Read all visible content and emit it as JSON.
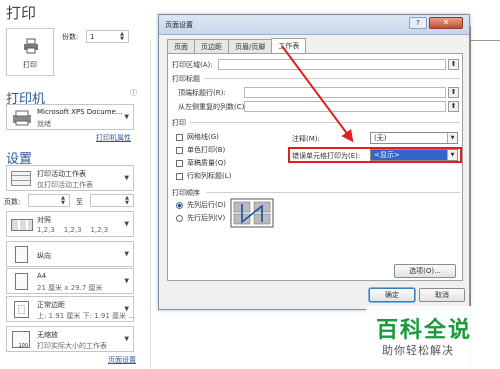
{
  "left": {
    "title": "打印",
    "print_button": "打印",
    "copies_label": "份数:",
    "copies_value": "1",
    "printer_heading": "打印机",
    "printer_name": "Microsoft XPS Docume...",
    "printer_status": "就绪",
    "printer_props_link": "打印机属性",
    "settings_heading": "设置",
    "setting_active": {
      "line1": "打印活动工作表",
      "line2": "仅打印活动工作表"
    },
    "pages_label": "页数:",
    "pages_to": "至",
    "setting_collate": {
      "line1": "对照",
      "line2": "1,2,3    1,2,3    1,2,3"
    },
    "setting_orientation": {
      "line1": "纵向"
    },
    "setting_paper": {
      "line1": "A4",
      "line2": "21 厘米 x 29.7 厘米"
    },
    "setting_margins": {
      "line1": "正常边距",
      "line2": "上: 1.91 厘米 下: 1.91 厘米 ..."
    },
    "setting_scale": {
      "line1": "无缩放",
      "line2": "打印实际大小的工作表"
    },
    "page_setup_link": "页面设置"
  },
  "dialog": {
    "title": "页面设置",
    "help_btn": "?",
    "close_btn": "✕",
    "tabs": [
      "页面",
      "页边距",
      "页眉/页脚",
      "工作表"
    ],
    "print_area_label": "打印区域(A):",
    "print_titles_heading": "打印标题",
    "top_rows_label": "顶端标题行(R):",
    "left_cols_label": "从左侧重复的列数(C):",
    "print_heading": "打印",
    "checkboxes": [
      "网格线(G)",
      "单色打印(B)",
      "草稿质量(Q)",
      "行和列标题(L)"
    ],
    "comments_label": "注释(M):",
    "comments_value": "(无)",
    "errors_label": "错误单元格打印为(E):",
    "errors_value": "<显示>",
    "page_order_heading": "打印顺序",
    "radios": [
      "先列后行(D)",
      "先行后列(V)"
    ],
    "options_btn": "选项(O)...",
    "ok_btn": "确定",
    "cancel_btn": "取消"
  },
  "watermark": {
    "line1": "百科全说",
    "line2": "助你轻松解决"
  },
  "colors": {
    "accent": "#2b579a",
    "highlight": "#3366cc",
    "annotation_red": "#e02020",
    "watermark_green": "#1a9a3a"
  }
}
